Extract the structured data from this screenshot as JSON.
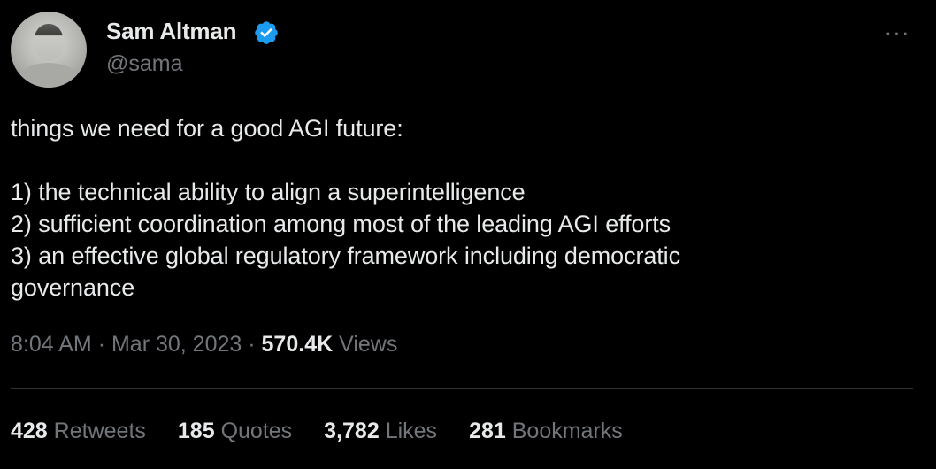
{
  "tweet": {
    "author": {
      "name": "Sam Altman",
      "handle": "@sama",
      "verified_icon": "verified-badge-icon",
      "verified_color": "#1d9bf0"
    },
    "more_icon": "more-options-icon",
    "text_lines": [
      "things we need for a good AGI future:",
      "",
      "1) the technical ability to align a superintelligence",
      "2) sufficient coordination among most of the leading AGI efforts",
      "3) an effective global regulatory framework including democratic",
      "governance"
    ],
    "meta": {
      "time": "8:04 AM",
      "separator": "·",
      "date": "Mar 30, 2023",
      "views_count": "570.4K",
      "views_label": "Views"
    },
    "stats": [
      {
        "count": "428",
        "label": "Retweets"
      },
      {
        "count": "185",
        "label": "Quotes"
      },
      {
        "count": "3,782",
        "label": "Likes"
      },
      {
        "count": "281",
        "label": "Bookmarks"
      }
    ]
  },
  "colors": {
    "background": "#000000",
    "primary_text": "#e7e9ea",
    "secondary_text": "#71767b",
    "divider": "#2f3336",
    "accent": "#1d9bf0"
  }
}
